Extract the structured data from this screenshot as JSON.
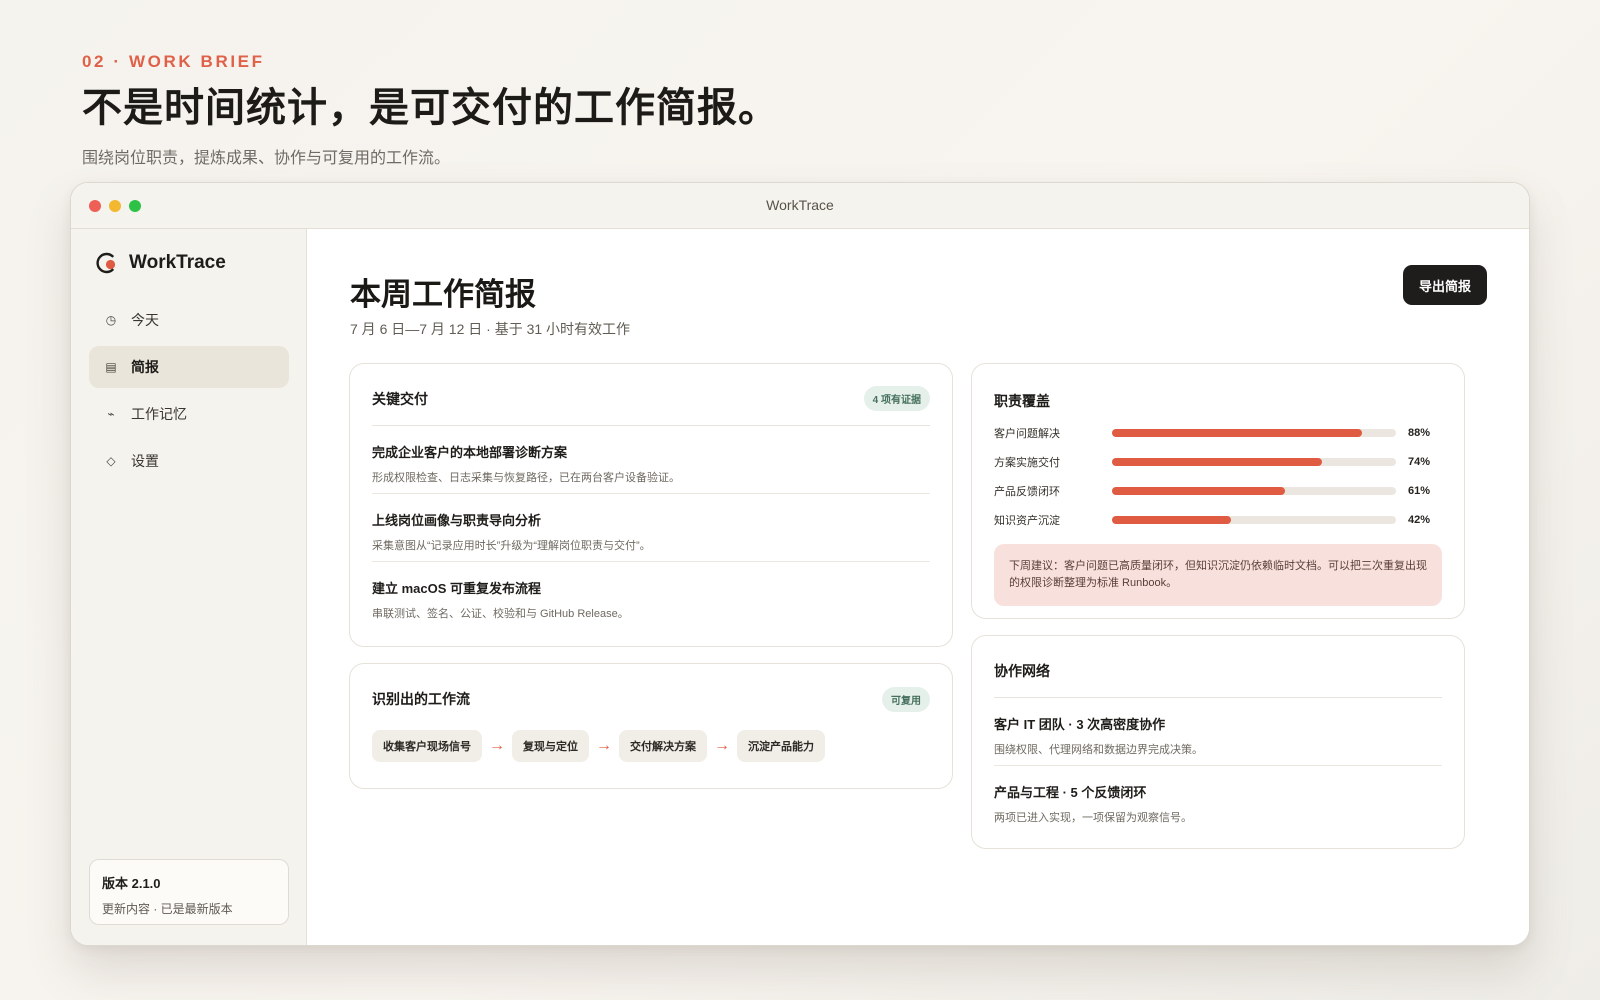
{
  "hero": {
    "eyebrow": "02 · WORK BRIEF",
    "title": "不是时间统计，是可交付的工作简报。",
    "subtitle": "围绕岗位职责，提炼成果、协作与可复用的工作流。"
  },
  "window": {
    "title": "WorkTrace"
  },
  "sidebar": {
    "brand": "WorkTrace",
    "items": [
      {
        "label": "今天",
        "icon": "clock-icon"
      },
      {
        "label": "简报",
        "icon": "document-icon"
      },
      {
        "label": "工作记忆",
        "icon": "activity-icon"
      },
      {
        "label": "设置",
        "icon": "diamond-icon"
      }
    ],
    "active_item": "简报",
    "version": {
      "title": "版本 2.1.0",
      "subtitle": "更新内容 · 已是最新版本"
    }
  },
  "main": {
    "title": "本周工作简报",
    "subtitle": "7 月 6 日—7 月 12 日 · 基于 31 小时有效工作",
    "export_label": "导出简报"
  },
  "deliverables": {
    "title": "关键交付",
    "badge": "4 项有证据",
    "items": [
      {
        "title": "完成企业客户的本地部署诊断方案",
        "description": "形成权限检查、日志采集与恢复路径，已在两台客户设备验证。"
      },
      {
        "title": "上线岗位画像与职责导向分析",
        "description": "采集意图从“记录应用时长”升级为“理解岗位职责与交付”。"
      },
      {
        "title": "建立 macOS 可重复发布流程",
        "description": "串联测试、签名、公证、校验和与 GitHub Release。"
      }
    ]
  },
  "workflow": {
    "title": "识别出的工作流",
    "badge": "可复用",
    "steps": [
      "收集客户现场信号",
      "复现与定位",
      "交付解决方案",
      "沉淀产品能力"
    ]
  },
  "coverage": {
    "title": "职责覆盖",
    "metrics": [
      {
        "label": "客户问题解决",
        "value": 88,
        "display": "88%"
      },
      {
        "label": "方案实施交付",
        "value": 74,
        "display": "74%"
      },
      {
        "label": "产品反馈闭环",
        "value": 61,
        "display": "61%"
      },
      {
        "label": "知识资产沉淀",
        "value": 42,
        "display": "42%"
      }
    ],
    "suggestion": "下周建议：客户问题已高质量闭环，但知识沉淀仍依赖临时文档。可以把三次重复出现的权限诊断整理为标准 Runbook。"
  },
  "network": {
    "title": "协作网络",
    "items": [
      {
        "title": "客户 IT 团队 · 3 次高密度协作",
        "description": "围绕权限、代理网络和数据边界完成决策。"
      },
      {
        "title": "产品与工程 · 5 个反馈闭环",
        "description": "两项已进入实现，一项保留为观察信号。"
      }
    ]
  },
  "colors": {
    "accent": "#DF5B42",
    "badge_bg": "#E5F0EA",
    "badge_text": "#46705D",
    "primary_button": "#1E1D1B",
    "suggestion_bg": "#F8E1DC"
  }
}
